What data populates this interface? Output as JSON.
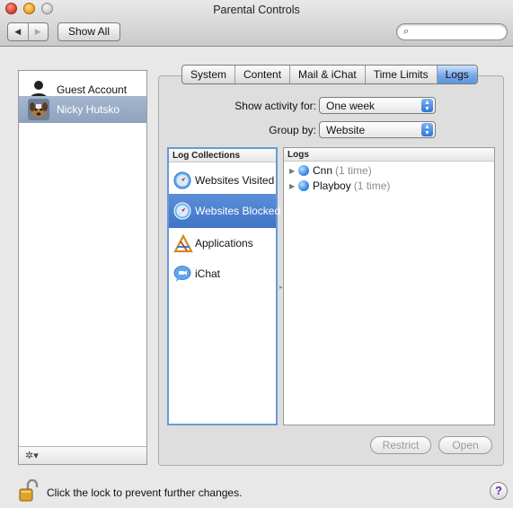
{
  "window": {
    "title": "Parental Controls"
  },
  "toolbar": {
    "back_icon": "back-arrow-icon",
    "forward_icon": "forward-arrow-icon",
    "show_all_label": "Show All",
    "search_value": "",
    "search_placeholder": ""
  },
  "accounts": {
    "items": [
      {
        "label": "Guest Account",
        "icon": "guest-user-icon",
        "selected": false
      },
      {
        "label": "Nicky Hutsko",
        "icon": "dog-avatar-icon",
        "selected": true
      }
    ],
    "footer_icon": "gear-icon",
    "footer_glyph": "✲▾"
  },
  "tabs": [
    {
      "label": "System",
      "active": false
    },
    {
      "label": "Content",
      "active": false
    },
    {
      "label": "Mail & iChat",
      "active": false
    },
    {
      "label": "Time Limits",
      "active": false
    },
    {
      "label": "Logs",
      "active": true
    }
  ],
  "filters": {
    "activity_label": "Show activity for:",
    "activity_value": "One week",
    "group_label": "Group by:",
    "group_value": "Website"
  },
  "log_collections": {
    "header": "Log Collections",
    "items": [
      {
        "label": "Websites Visited",
        "icon": "safari-compass-icon",
        "selected": false
      },
      {
        "label": "Websites Blocked",
        "icon": "safari-compass-icon",
        "selected": true
      },
      {
        "label": "Applications",
        "icon": "applications-icon",
        "selected": false
      },
      {
        "label": "iChat",
        "icon": "ichat-icon",
        "selected": false
      }
    ]
  },
  "logs": {
    "header": "Logs",
    "rows": [
      {
        "site": "Cnn",
        "count": "(1 time)"
      },
      {
        "site": "Playboy",
        "count": "(1 time)"
      }
    ]
  },
  "buttons": {
    "restrict": "Restrict",
    "open": "Open"
  },
  "footer": {
    "lock_text": "Click the lock to prevent further changes.",
    "lock_icon": "unlocked-padlock-icon",
    "help_label": "?"
  },
  "colors": {
    "selection_blue": "#3f74c6",
    "account_selection": "#8da2bf",
    "active_tab": "#78a7e8"
  }
}
